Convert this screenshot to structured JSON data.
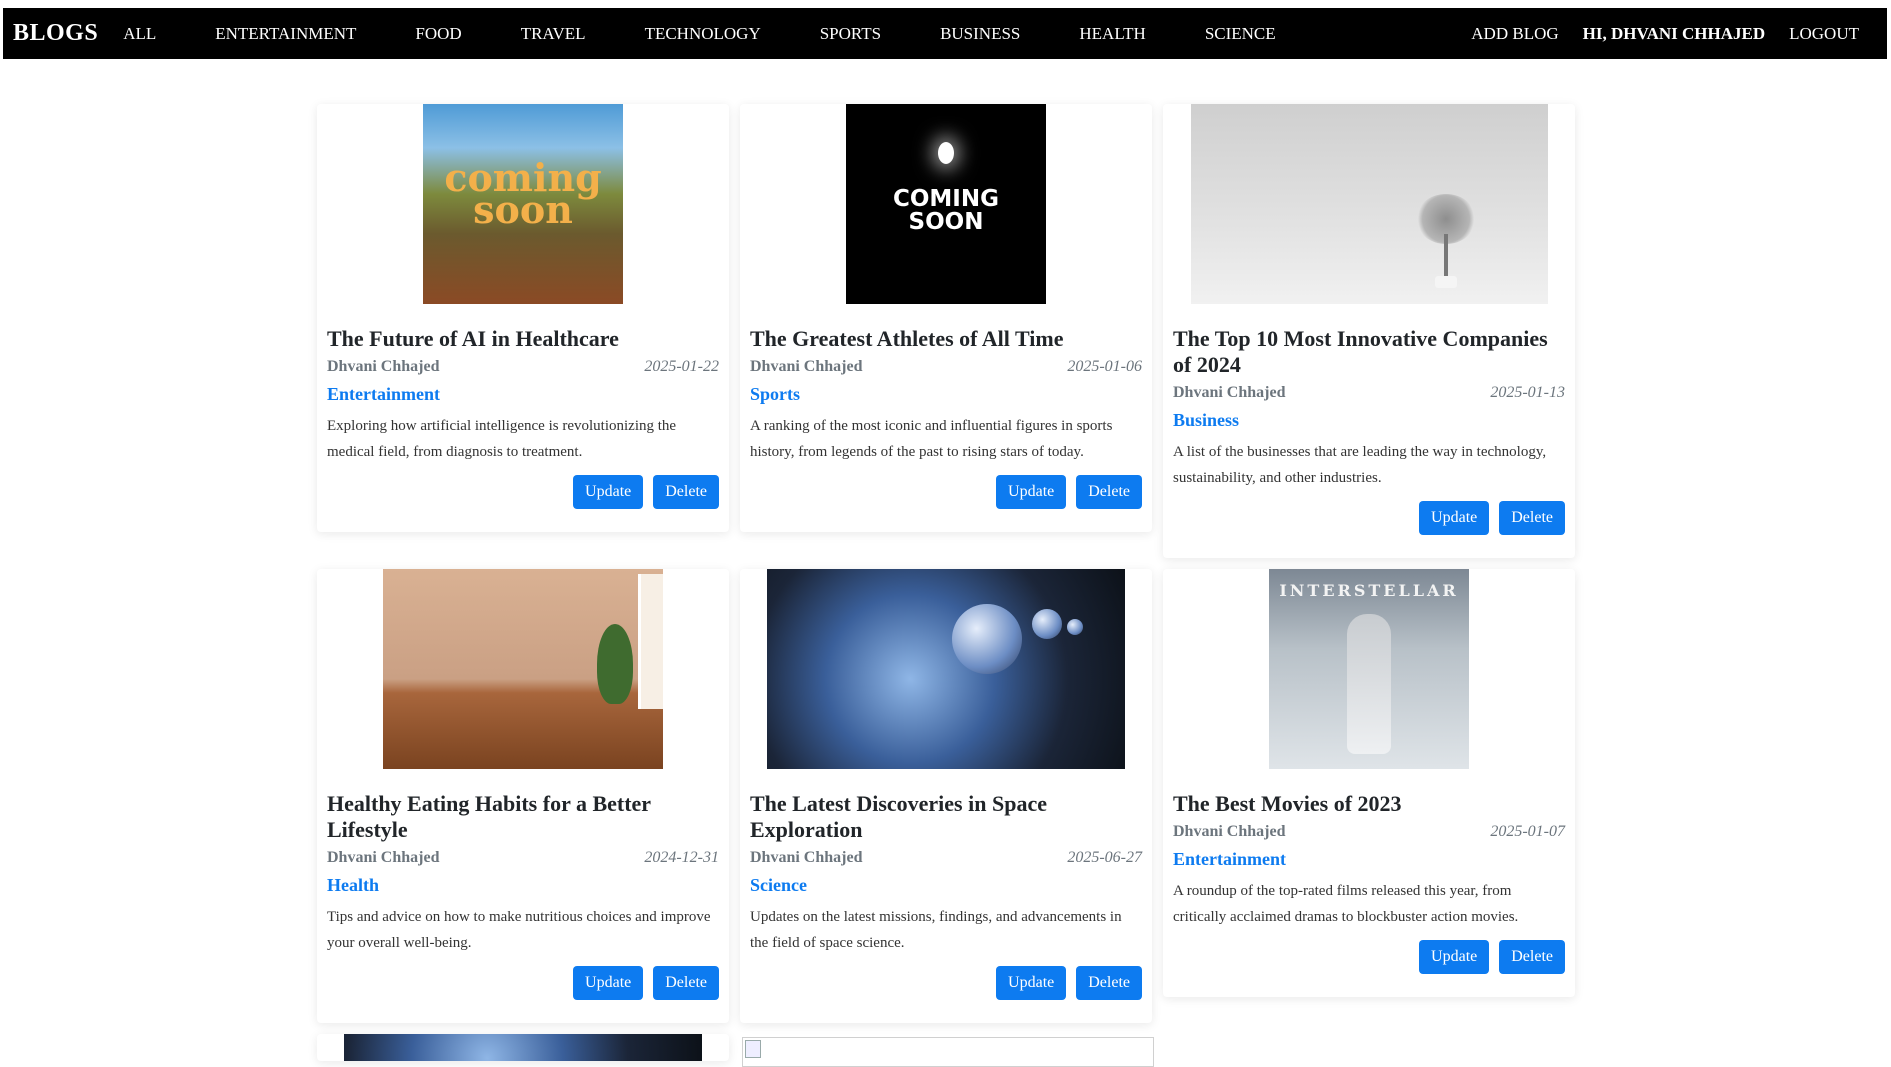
{
  "navbar": {
    "brand": "BLOGS",
    "links": [
      "ALL",
      "ENTERTAINMENT",
      "FOOD",
      "TRAVEL",
      "TECHNOLOGY",
      "SPORTS",
      "BUSINESS",
      "HEALTH",
      "SCIENCE"
    ],
    "add_blog": "ADD BLOG",
    "greeting": "HI, DHVANI CHHAJED",
    "logout": "LOGOUT"
  },
  "buttons": {
    "update": "Update",
    "delete": "Delete"
  },
  "images": {
    "coming_soon_1": "coming soon",
    "coming_soon_2_line1": "COMING",
    "coming_soon_2_line2": "SOON",
    "interstellar": "INTERSTELLAR"
  },
  "posts": [
    {
      "title": "The Future of AI in Healthcare",
      "author": "Dhvani Chhajed",
      "date": "2025-01-22",
      "category": "Entertainment",
      "description": "Exploring how artificial intelligence is revolutionizing the medical field, from diagnosis to treatment."
    },
    {
      "title": "The Greatest Athletes of All Time",
      "author": "Dhvani Chhajed",
      "date": "2025-01-06",
      "category": "Sports",
      "description": "A ranking of the most iconic and influential figures in sports history, from legends of the past to rising stars of today."
    },
    {
      "title": "The Top 10 Most Innovative Companies of 2024",
      "author": "Dhvani Chhajed",
      "date": "2025-01-13",
      "category": "Business",
      "description": "A list of the businesses that are leading the way in technology, sustainability, and other industries."
    },
    {
      "title": "Healthy Eating Habits for a Better Lifestyle",
      "author": "Dhvani Chhajed",
      "date": "2024-12-31",
      "category": "Health",
      "description": "Tips and advice on how to make nutritious choices and improve your overall well-being."
    },
    {
      "title": "The Latest Discoveries in Space Exploration",
      "author": "Dhvani Chhajed",
      "date": "2025-06-27",
      "category": "Science",
      "description": "Updates on the latest missions, findings, and advancements in the field of space science."
    },
    {
      "title": "The Best Movies of 2023",
      "author": "Dhvani Chhajed",
      "date": "2025-01-07",
      "category": "Entertainment",
      "description": "A roundup of the top-rated films released this year, from critically acclaimed dramas to blockbuster action movies."
    }
  ]
}
